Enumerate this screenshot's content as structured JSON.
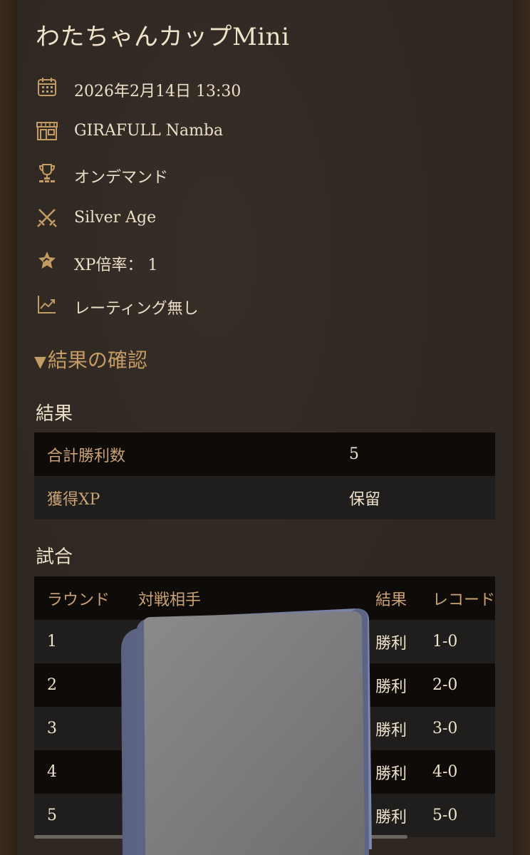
{
  "event": {
    "title": "わたちゃんカップMini",
    "info": [
      {
        "icon": "calendar-icon",
        "text": "2026年2月14日 13:30"
      },
      {
        "icon": "store-icon",
        "text": "GIRAFULL Namba"
      },
      {
        "icon": "trophy-icon",
        "text": "オンデマンド"
      },
      {
        "icon": "crossed-swords-icon",
        "text": "Silver Age"
      },
      {
        "icon": "star-badge-icon",
        "text": "XP倍率： 1"
      },
      {
        "icon": "trend-chart-icon",
        "text": "レーティング無し"
      }
    ]
  },
  "results_section": {
    "toggle_label": "結果の確認",
    "results_heading": "結果",
    "summary": [
      {
        "label": "合計勝利数",
        "value": "5"
      },
      {
        "label": "獲得XP",
        "value": "保留"
      }
    ],
    "matches_heading": "試合",
    "match_headers": {
      "round": "ラウンド",
      "opponent": "対戦相手",
      "result": "結果",
      "record": "レコード"
    },
    "matches": [
      {
        "round": "1",
        "opponent": "",
        "result": "勝利",
        "record": "1-0"
      },
      {
        "round": "2",
        "opponent": "",
        "result": "勝利",
        "record": "2-0"
      },
      {
        "round": "3",
        "opponent": "",
        "result": "勝利",
        "record": "3-0"
      },
      {
        "round": "4",
        "opponent": "",
        "result": "勝利",
        "record": "4-0"
      },
      {
        "round": "5",
        "opponent": "",
        "result": "勝利",
        "record": "5-0"
      }
    ]
  },
  "colors": {
    "accent": "#c49b63",
    "label": "#c9a275",
    "text": "#ecdfc8",
    "panel": "#2e2722",
    "row_dark": "#0e0b09",
    "row_light": "#1f1e1c"
  }
}
